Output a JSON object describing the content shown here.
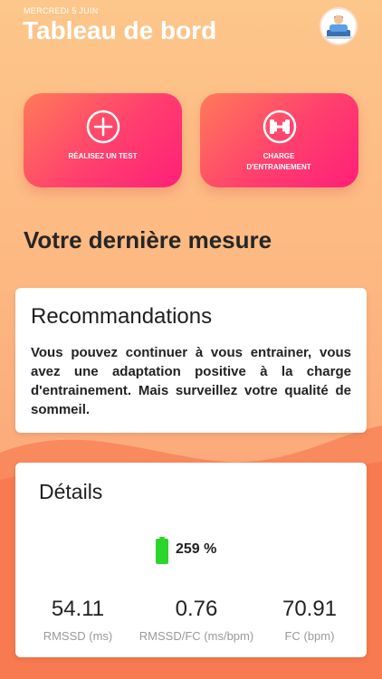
{
  "header": {
    "date": "MERCREDI 5 JUIN",
    "title": "Tableau de bord"
  },
  "actions": {
    "test_label": "RÉALISEZ UN TEST",
    "charge_label": "CHARGE D'ENTRAINEMENT"
  },
  "last_measure": {
    "title": "Votre dernière mesure"
  },
  "recommendations": {
    "title": "Recommandations",
    "text": "Vous pouvez continuer à vous entrainer, vous avez une adaptation positive à la charge d'entrainement. Mais surveillez votre qualité de sommeil."
  },
  "details": {
    "title": "Détails",
    "percentage": "259 %",
    "metrics": [
      {
        "value": "54.11",
        "label": "RMSSD (ms)"
      },
      {
        "value": "0.76",
        "label": "RMSSD/FC (ms/bpm)"
      },
      {
        "value": "70.91",
        "label": "FC (bpm)"
      }
    ]
  },
  "colors": {
    "accent_pink": "#ff3f6e",
    "accent_orange": "#ff7a59",
    "battery_green": "#2bd52b",
    "background_peach": "#fdbf85"
  },
  "icons": [
    "avatar",
    "plus-circle-icon",
    "dumbbell-icon",
    "battery-icon"
  ]
}
